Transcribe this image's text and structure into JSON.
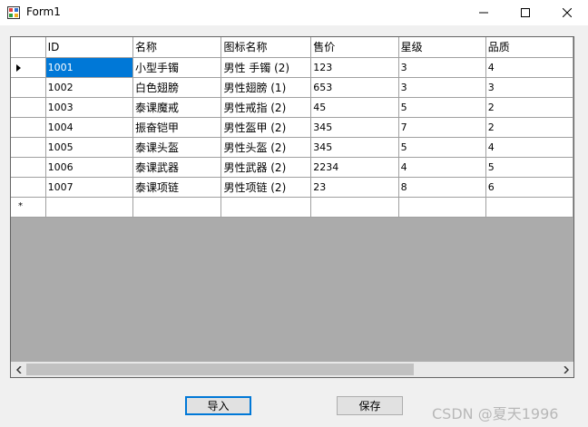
{
  "window": {
    "title": "Form1"
  },
  "grid": {
    "columns": [
      "ID",
      "名称",
      "图标名称",
      "售价",
      "星级",
      "品质"
    ],
    "rows": [
      {
        "id": "1001",
        "name": "小型手镯",
        "icon": "男性 手镯  (2)",
        "price": "123",
        "star": "3",
        "quality": "4"
      },
      {
        "id": "1002",
        "name": "白色翅膀",
        "icon": "男性翅膀 (1)",
        "price": "653",
        "star": "3",
        "quality": "3"
      },
      {
        "id": "1003",
        "name": "泰课魔戒",
        "icon": "男性戒指 (2)",
        "price": "45",
        "star": "5",
        "quality": "2"
      },
      {
        "id": "1004",
        "name": "振奋铠甲",
        "icon": "男性盔甲 (2)",
        "price": "345",
        "star": "7",
        "quality": "2"
      },
      {
        "id": "1005",
        "name": "泰课头盔",
        "icon": "男性头盔 (2)",
        "price": "345",
        "star": "5",
        "quality": "4"
      },
      {
        "id": "1006",
        "name": "泰课武器",
        "icon": "男性武器 (2)",
        "price": "2234",
        "star": "4",
        "quality": "5"
      },
      {
        "id": "1007",
        "name": "泰课项链",
        "icon": "男性项链 (2)",
        "price": "23",
        "star": "8",
        "quality": "6"
      }
    ],
    "new_row_marker": "*"
  },
  "buttons": {
    "import": "导入",
    "save": "保存"
  },
  "watermark": "CSDN @夏天1996"
}
